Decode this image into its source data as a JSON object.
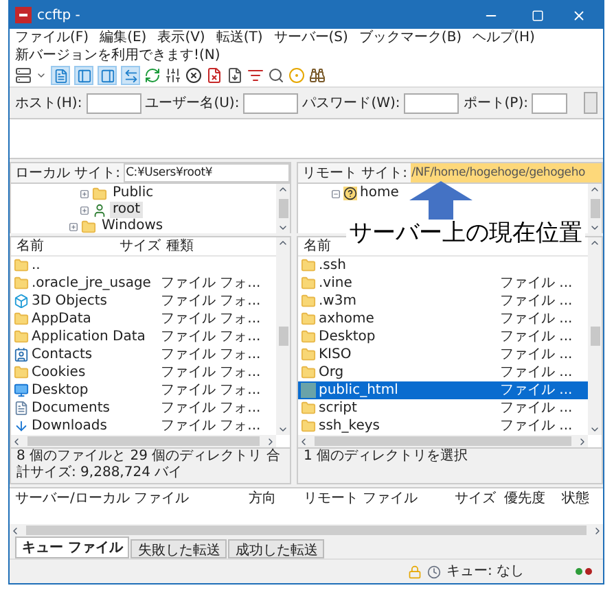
{
  "window": {
    "title": "ccftp -"
  },
  "menu": [
    "ファイル(F)",
    "編集(E)",
    "表示(V)",
    "転送(T)",
    "サーバー(S)",
    "ブックマーク(B)",
    "ヘルプ(H)",
    "新バージョンを利用できます!(N)"
  ],
  "toolbar": {
    "toggles": [
      {
        "pressed": true
      },
      {
        "pressed": true
      },
      {
        "pressed": true
      },
      {
        "pressed": true
      }
    ]
  },
  "quickconnect": {
    "fields": [
      {
        "label": "ホスト(H):"
      },
      {
        "label": "ユーザー名(U):"
      },
      {
        "label": "パスワード(W):"
      },
      {
        "label": "ポート(P):"
      }
    ]
  },
  "local": {
    "site_label": "ローカル サイト:",
    "path": "C:¥Users¥root¥",
    "tree": [
      {
        "children": [
          {
            "label": "Public",
            "kind": "folder",
            "selected": false
          },
          {
            "label": "root",
            "kind": "user",
            "selected": true
          }
        ]
      },
      {
        "label": "Windows",
        "kind": "folder",
        "selected": false
      }
    ],
    "columns": [
      "名前",
      "サイズ",
      "種類"
    ],
    "rows": [
      {
        "name": "..",
        "kind": "folder"
      },
      {
        "name": ".oracle_jre_usage",
        "type": "ファイル フォ...",
        "kind": "folder"
      },
      {
        "name": "3D Objects",
        "type": "ファイル フォ...",
        "kind": "cube"
      },
      {
        "name": "AppData",
        "type": "ファイル フォ...",
        "kind": "folder"
      },
      {
        "name": "Application Data",
        "type": "ファイル フォ...",
        "kind": "folder"
      },
      {
        "name": "Contacts",
        "type": "ファイル フォ...",
        "kind": "contacts"
      },
      {
        "name": "Cookies",
        "type": "ファイル フォ...",
        "kind": "folder"
      },
      {
        "name": "Desktop",
        "type": "ファイル フォ...",
        "kind": "desktop"
      },
      {
        "name": "Documents",
        "type": "ファイル フォ...",
        "kind": "documents"
      },
      {
        "name": "Downloads",
        "type": "ファイル フォ...",
        "kind": "downloads"
      }
    ],
    "status": "8 個のファイルと 29 個のディレクトリ 合計サイズ: 9,288,724 バイ"
  },
  "remote": {
    "site_label": "リモート サイト:",
    "path": "/NF/home/hogehoge/gehogeho",
    "tree": [
      {
        "label": "home",
        "expanded": true
      }
    ],
    "columns": [
      "名前"
    ],
    "rows": [
      {
        "name": ".ssh",
        "type": "",
        "kind": "folder",
        "selected": false
      },
      {
        "name": ".vine",
        "type": "ファイル ...",
        "kind": "folder",
        "selected": false
      },
      {
        "name": ".w3m",
        "type": "ファイル ...",
        "kind": "folder",
        "selected": false
      },
      {
        "name": "axhome",
        "type": "ファイル ...",
        "kind": "folder",
        "selected": false
      },
      {
        "name": "Desktop",
        "type": "ファイル ...",
        "kind": "folder",
        "selected": false
      },
      {
        "name": "KISO",
        "type": "ファイル ...",
        "kind": "folder",
        "selected": false
      },
      {
        "name": "Org",
        "type": "ファイル ...",
        "kind": "folder",
        "selected": false
      },
      {
        "name": "public_html",
        "type": "ファイル ...",
        "kind": "link",
        "selected": true
      },
      {
        "name": "script",
        "type": "ファイル ...",
        "kind": "folder",
        "selected": false
      },
      {
        "name": "ssh_keys",
        "type": "ファイル ...",
        "kind": "folder",
        "selected": false
      }
    ],
    "status": "1 個のディレクトリを選択"
  },
  "queue": {
    "columns": [
      "サーバー/ローカル ファイル",
      "方向",
      "リモート ファイル",
      "サイズ",
      "優先度",
      "状態"
    ],
    "tabs": [
      {
        "label": "キュー ファイル",
        "selected": true
      },
      {
        "label": "失敗した転送",
        "selected": false
      },
      {
        "label": "成功した転送",
        "selected": false
      }
    ]
  },
  "status_bar": {
    "queue": "キュー: なし"
  },
  "annotation": {
    "text": "サーバー上の現在位置"
  }
}
